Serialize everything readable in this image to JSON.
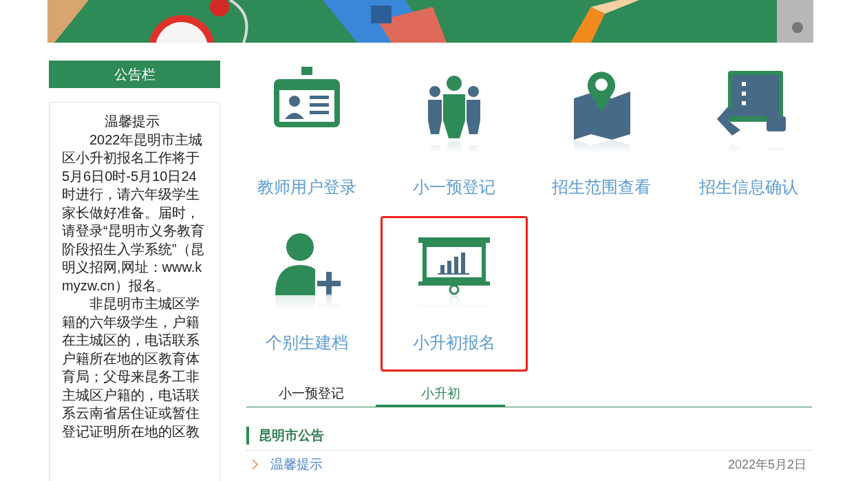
{
  "sidebar": {
    "title": "公告栏",
    "notice": {
      "heading": "温馨提示",
      "paragraphs": [
        "2022年昆明市主城区小升初报名工作将于5月6日0时-5月10日24时进行，请六年级学生家长做好准备。届时，请登录“昆明市义务教育阶段招生入学系统”（昆明义招网,网址：www.kmyzw.cn）报名。",
        "非昆明市主城区学籍的六年级学生，户籍在主城区的，电话联系户籍所在地的区教育体育局；父母来昆务工非主城区户籍的，电话联系云南省居住证或暂住登记证明所在地的区教"
      ]
    }
  },
  "shortcuts": [
    {
      "kind": "id-card",
      "label": "教师用户登录",
      "highlighted": false
    },
    {
      "kind": "people",
      "label": "小一预登记",
      "highlighted": false
    },
    {
      "kind": "map",
      "label": "招生范围查看",
      "highlighted": false
    },
    {
      "kind": "tablet",
      "label": "招生信息确认",
      "highlighted": false
    },
    {
      "kind": "add-user",
      "label": "个别生建档",
      "highlighted": false
    },
    {
      "kind": "board",
      "label": "小升初报名",
      "highlighted": true
    }
  ],
  "tabs": [
    {
      "label": "小一预登记",
      "selected": false
    },
    {
      "label": "小升初",
      "selected": true
    }
  ],
  "notices": {
    "title": "昆明市公告",
    "items": [
      {
        "title": "温馨提示",
        "date": "2022年5月2日"
      }
    ]
  }
}
